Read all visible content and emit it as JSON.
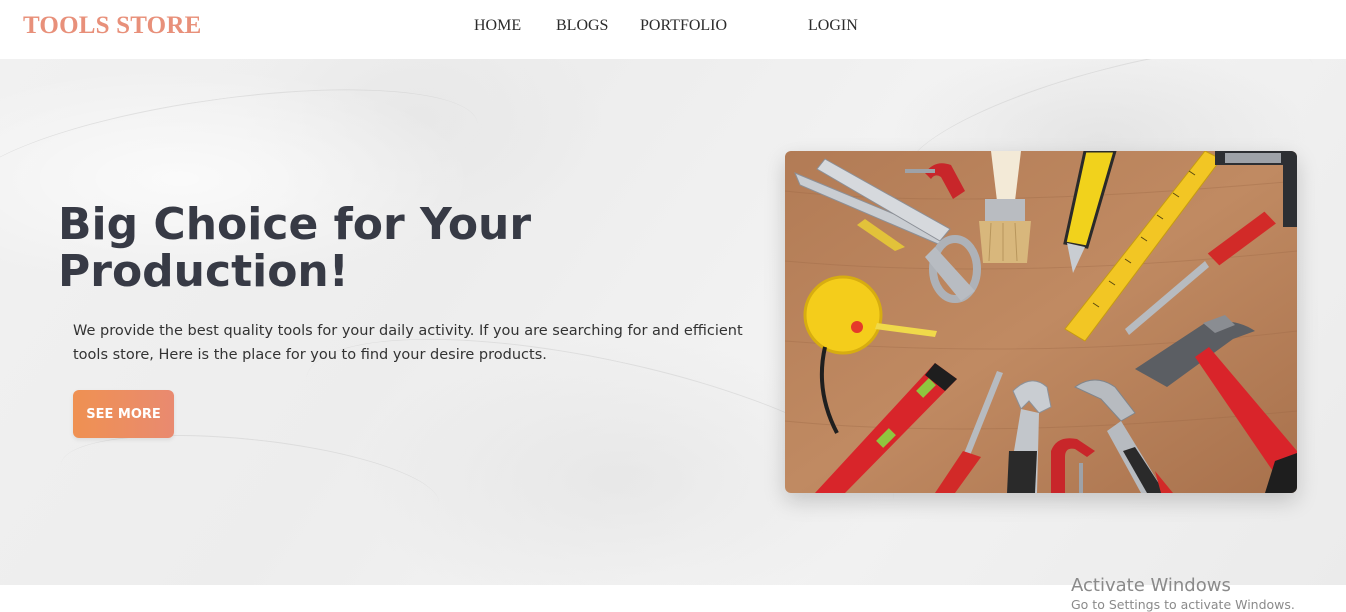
{
  "brand": "TOOLS STORE",
  "nav": {
    "home": "HOME",
    "blogs": "BLOGS",
    "portfolio": "PORTFOLIO",
    "login": "LOGIN"
  },
  "hero": {
    "headline_line1": "Big Choice for Your",
    "headline_line2": "Production!",
    "description_line1": "We provide the best quality tools for your daily activity. If you are searching for and efficient",
    "description_line2": "tools store, Here is the place for you to find your desire products.",
    "cta_label": "SEE MORE",
    "image_subject": "assorted hand tools on wooden table"
  },
  "watermark": {
    "title": "Activate Windows",
    "subtitle": "Go to Settings to activate Windows."
  },
  "colors": {
    "brand": "#e8907a",
    "cta_start": "#ef9152",
    "cta_end": "#e98a70",
    "headline": "#373a45",
    "nav_text": "#2b2b2b"
  }
}
